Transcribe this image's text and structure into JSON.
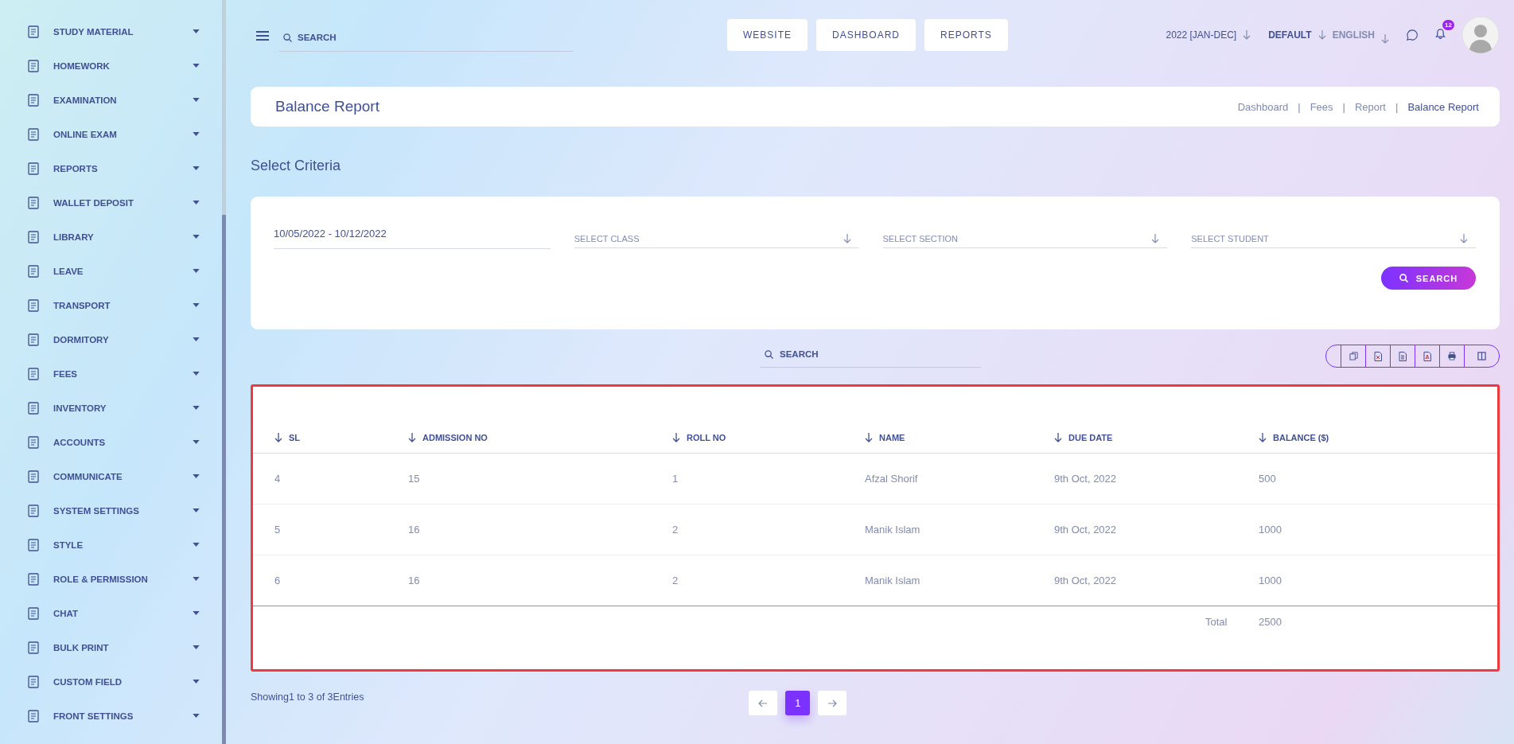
{
  "sidebar": {
    "items": [
      {
        "label": "STUDY MATERIAL"
      },
      {
        "label": "HOMEWORK"
      },
      {
        "label": "EXAMINATION"
      },
      {
        "label": "ONLINE EXAM"
      },
      {
        "label": "REPORTS"
      },
      {
        "label": "WALLET DEPOSIT"
      },
      {
        "label": "LIBRARY"
      },
      {
        "label": "LEAVE"
      },
      {
        "label": "TRANSPORT"
      },
      {
        "label": "DORMITORY"
      },
      {
        "label": "FEES"
      },
      {
        "label": "INVENTORY"
      },
      {
        "label": "ACCOUNTS"
      },
      {
        "label": "COMMUNICATE"
      },
      {
        "label": "SYSTEM SETTINGS"
      },
      {
        "label": "STYLE"
      },
      {
        "label": "ROLE & PERMISSION"
      },
      {
        "label": "CHAT"
      },
      {
        "label": "BULK PRINT"
      },
      {
        "label": "CUSTOM FIELD"
      },
      {
        "label": "FRONT SETTINGS"
      }
    ]
  },
  "header": {
    "search": {
      "placeholder": "SEARCH"
    },
    "nav_buttons": [
      "WEBSITE",
      "DASHBOARD",
      "REPORTS"
    ],
    "session": "2022 [JAN-DEC]",
    "style": "DEFAULT",
    "language": "ENGLISH",
    "notification_count": "12"
  },
  "page_header": {
    "title": "Balance Report",
    "breadcrumbs": [
      "Dashboard",
      "Fees",
      "Report",
      "Balance Report"
    ],
    "breadcrumb_separator": "|"
  },
  "criteria": {
    "heading": "Select Criteria",
    "date_range": "10/05/2022 - 10/12/2022",
    "selects": [
      {
        "placeholder": "SELECT CLASS"
      },
      {
        "placeholder": "SELECT SECTION"
      },
      {
        "placeholder": "SELECT STUDENT"
      }
    ],
    "search_button": "SEARCH"
  },
  "table_search": {
    "placeholder": "SEARCH"
  },
  "table": {
    "columns": [
      "SL",
      "ADMISSION NO",
      "ROLL NO",
      "NAME",
      "DUE DATE",
      "BALANCE ($)"
    ],
    "rows": [
      [
        "4",
        "15",
        "1",
        "Afzal Shorif",
        "9th Oct, 2022",
        "500"
      ],
      [
        "5",
        "16",
        "2",
        "Manik Islam",
        "9th Oct, 2022",
        "1000"
      ],
      [
        "6",
        "16",
        "2",
        "Manik Islam",
        "9th Oct, 2022",
        "1000"
      ]
    ],
    "total_label": "Total",
    "total_value": "2500"
  },
  "footer": {
    "info": "Showing1 to 3 of 3Entries",
    "pages": [
      {
        "label": "1",
        "selected": true
      }
    ]
  }
}
